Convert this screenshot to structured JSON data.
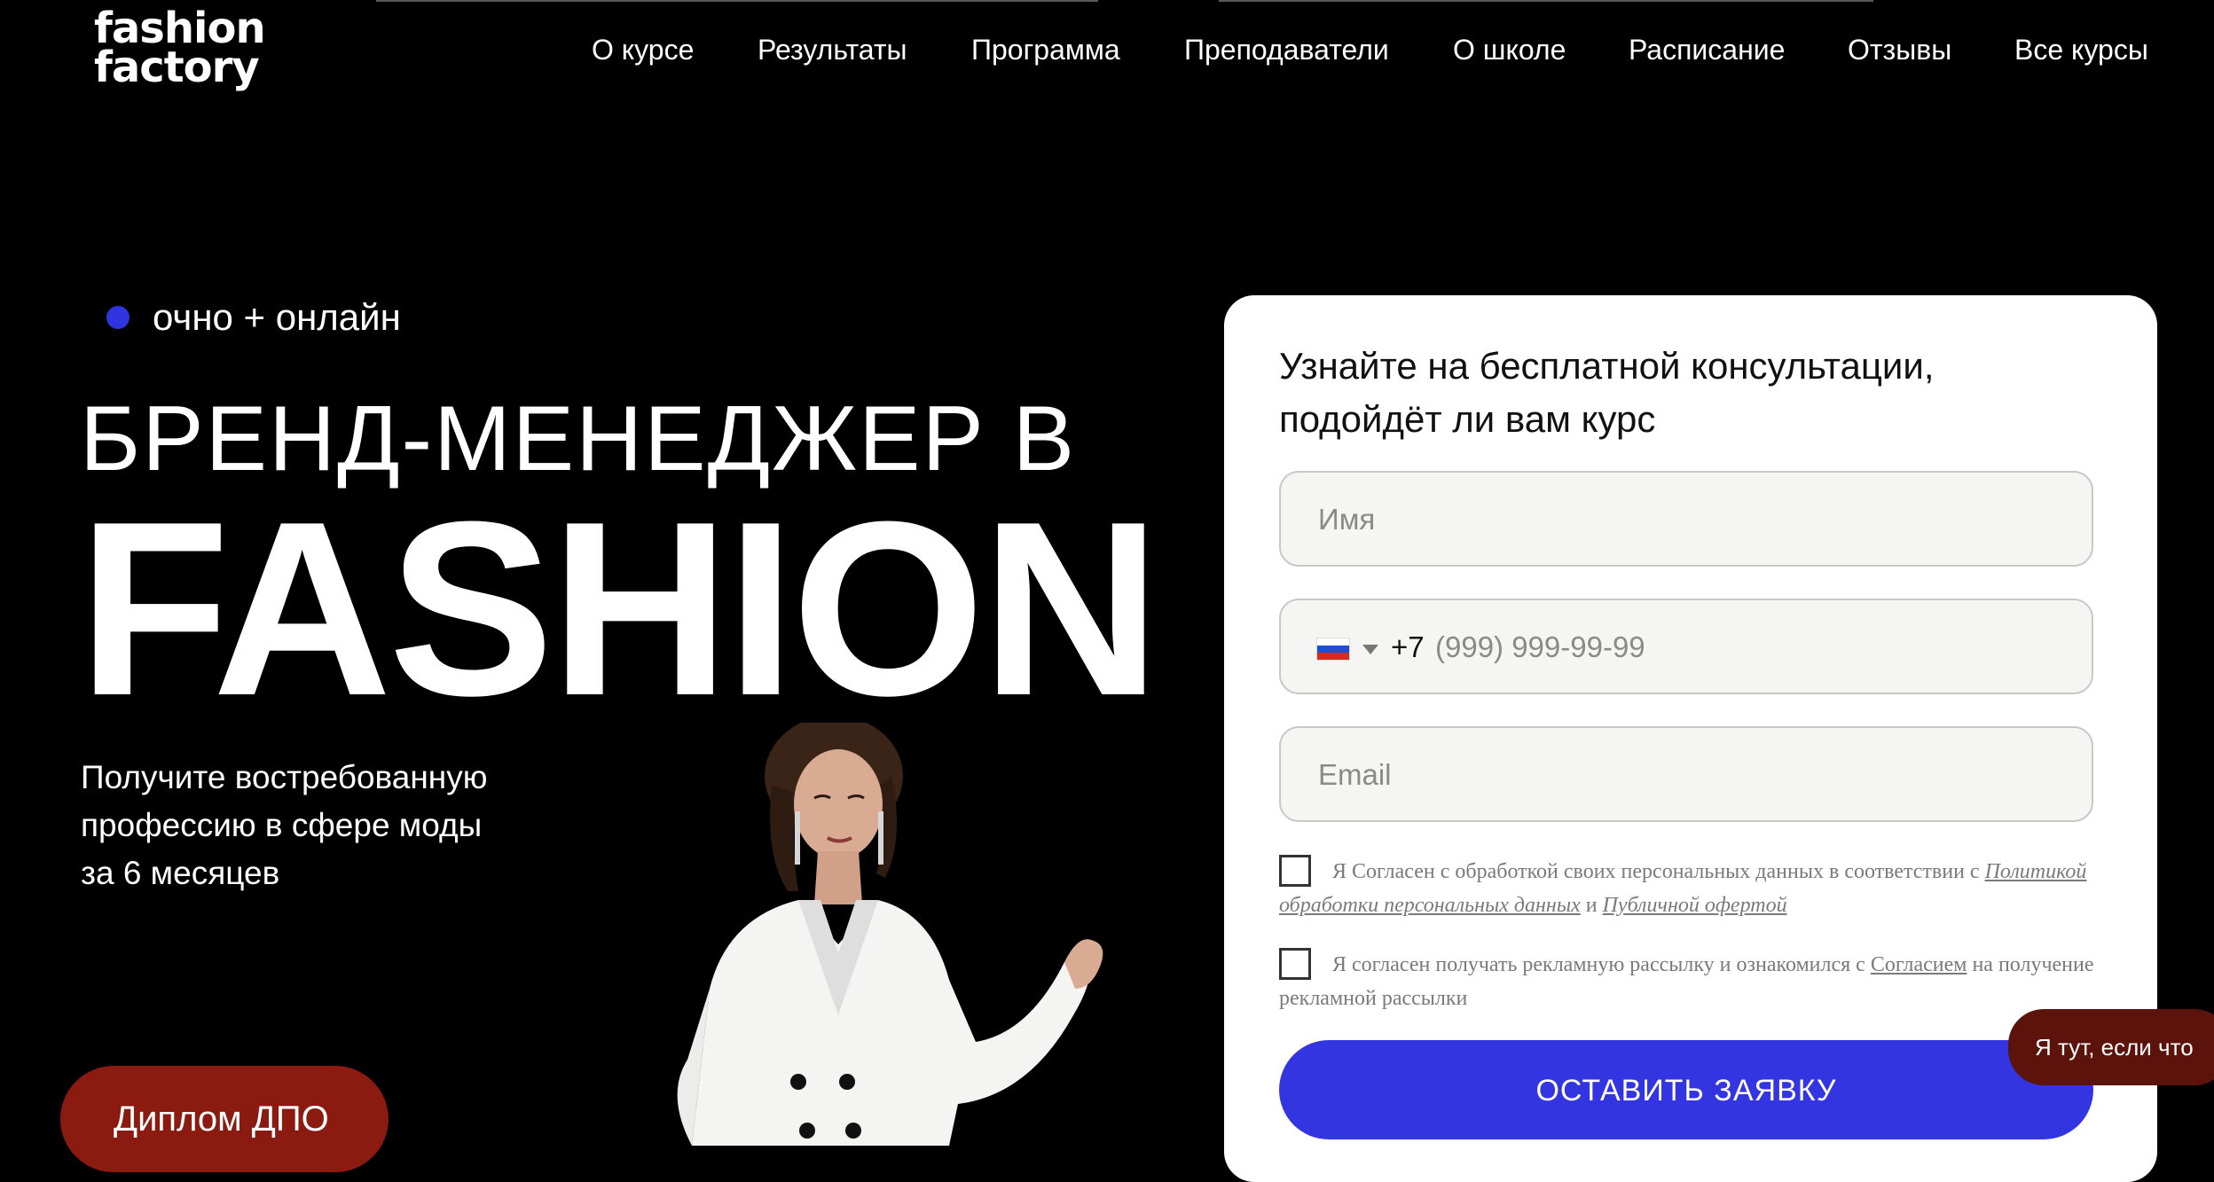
{
  "header": {
    "logo_line1": "fashion",
    "logo_line2": "factory",
    "nav": [
      {
        "label": "О курсе"
      },
      {
        "label": "Результаты"
      },
      {
        "label": "Программа"
      },
      {
        "label": "Преподаватели"
      },
      {
        "label": "О школе"
      },
      {
        "label": "Расписание"
      },
      {
        "label": "Отзывы"
      },
      {
        "label": "Все курсы"
      }
    ]
  },
  "hero": {
    "format_tag": "очно + онлайн",
    "title_line1": "БРЕНД-МЕНЕДЖЕР В",
    "title_line2": "FASHION",
    "subtitle_line1": "Получите востребованную",
    "subtitle_line2": "профессию в сфере моды",
    "subtitle_line3": "за 6 месяцев",
    "diploma_badge": "Диплом ДПО",
    "accent_color": "#3034e0"
  },
  "form": {
    "title": "Узнайте на бесплатной консультации, подойдёт ли вам курс",
    "name_placeholder": "Имя",
    "phone_prefix": "+7",
    "phone_placeholder": "(999) 999-99-99",
    "phone_country_flag": "russia-flag-icon",
    "email_placeholder": "Email",
    "consent1_text": "Я Согласен с обработкой своих персональных данных в соответствии с",
    "consent1_link1": "Политикой обработки персональных данных",
    "consent1_and": "и",
    "consent1_link2": "Публичной офертой",
    "consent2_text": "Я согласен получать рекламную рассылку и ознакомился с",
    "consent2_link": "Согласием",
    "consent2_tail": "на получение рекламной рассылки",
    "submit_label": "ОСТАВИТЬ ЗАЯВКУ",
    "button_color": "#3336e0"
  },
  "chat_widget": {
    "label": "Я тут, если что"
  }
}
